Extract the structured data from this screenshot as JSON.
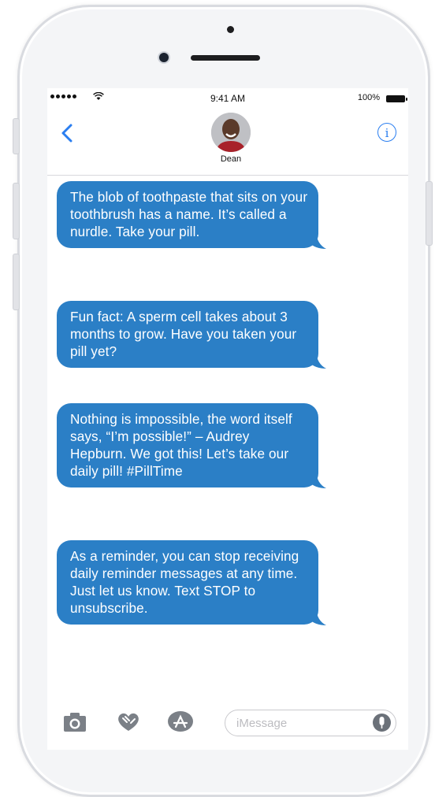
{
  "status_bar": {
    "time": "9:41 AM",
    "battery": "100%"
  },
  "header": {
    "contact_name": "Dean"
  },
  "messages": [
    {
      "text": "The blob of toothpaste that sits on your toothbrush has a name. It’s called a nurdle. Take your pill."
    },
    {
      "text": "Fun fact: A sperm cell takes about 3 months to grow. Have you taken your pill yet?"
    },
    {
      "text": "Nothing is impossible, the word itself says, “I’m possible!” – Audrey Hepburn. We got this! Let’s take our daily pill! #PillTime"
    },
    {
      "text": "As a reminder, you can stop receiving daily reminder messages at any time. Just let us know. Text STOP to unsubscribe."
    }
  ],
  "input": {
    "placeholder": "iMessage"
  },
  "icons": {
    "back": "chevron-left-icon",
    "info": "info-icon",
    "camera": "camera-icon",
    "digital_touch": "heart-hands-icon",
    "app_store": "app-store-icon",
    "microphone": "microphone-icon"
  },
  "colors": {
    "bubble": "#2b7fc6",
    "accent": "#2a7ef0"
  }
}
